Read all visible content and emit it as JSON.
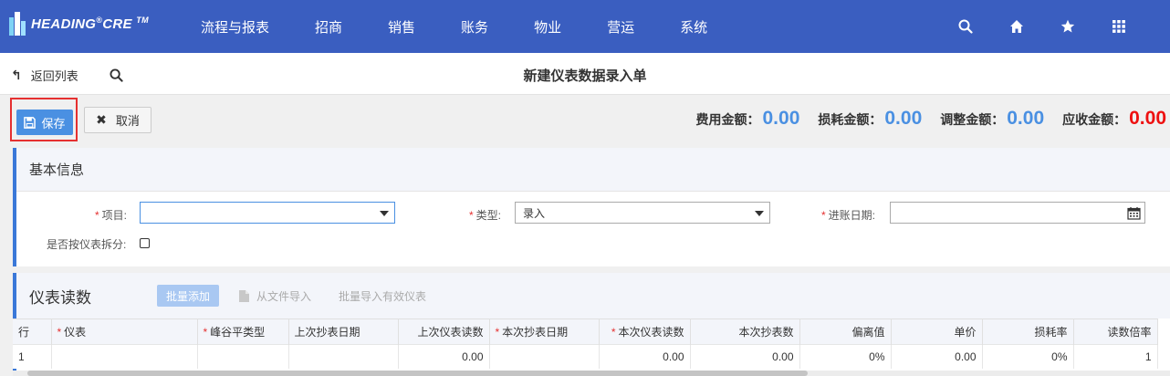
{
  "app": {
    "logo_text": "HEADING",
    "logo_sup": "®",
    "logo_text2": "CRE",
    "logo_tm": "TM"
  },
  "nav": {
    "items": [
      "流程与报表",
      "招商",
      "销售",
      "账务",
      "物业",
      "营运",
      "系统"
    ]
  },
  "top_icons": [
    "search-icon",
    "home-icon",
    "star-icon",
    "apps-grid-icon"
  ],
  "subheader": {
    "back_label": "返回列表",
    "page_title": "新建仪表数据录入单"
  },
  "actions": {
    "save_label": "保存",
    "cancel_label": "取消"
  },
  "totals": [
    {
      "label": "费用金额：",
      "value": "0.00",
      "color": "#4a90e2"
    },
    {
      "label": "损耗金额：",
      "value": "0.00",
      "color": "#4a90e2"
    },
    {
      "label": "调整金额：",
      "value": "0.00",
      "color": "#4a90e2"
    },
    {
      "label": "应收金额：",
      "value": "0.00",
      "color": "#ee1111"
    }
  ],
  "basic_info": {
    "title": "基本信息",
    "project_label": "项目:",
    "project_value": "",
    "type_label": "类型:",
    "type_value": "录入",
    "date_label": "进账日期:",
    "date_value": "",
    "split_label": "是否按仪表拆分:",
    "split_checked": false
  },
  "meter_readings": {
    "title": "仪表读数",
    "batch_add_label": "批量添加",
    "import_file_label": "从文件导入",
    "batch_import_label": "批量导入有效仪表",
    "columns": [
      "行",
      "仪表",
      "峰谷平类型",
      "上次抄表日期",
      "上次仪表读数",
      "本次抄表日期",
      "本次仪表读数",
      "本次抄表数",
      "偏离值",
      "单价",
      "损耗率",
      "读数倍率"
    ],
    "rows": [
      [
        "1",
        "",
        "",
        "",
        "0.00",
        "",
        "0.00",
        "0.00",
        "0%",
        "0.00",
        "0%",
        "1"
      ]
    ]
  },
  "colors": {
    "nav_bg": "#3a5ec0",
    "primary": "#4a90e2",
    "danger": "#ee1111",
    "highlight_border": "#e53030"
  }
}
